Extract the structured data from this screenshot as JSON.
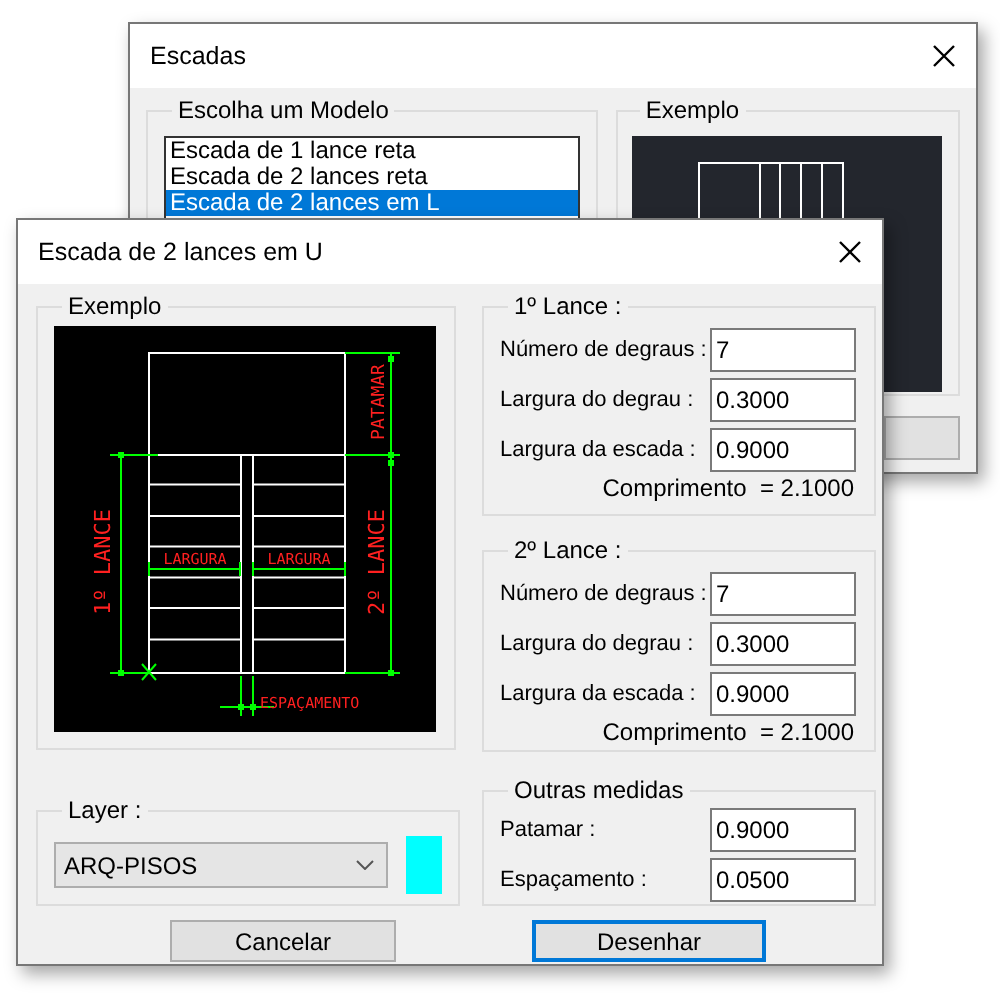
{
  "back_window": {
    "title": "Escadas",
    "model_group": {
      "label": "Escolha um Modelo",
      "items": [
        {
          "label": "Escada de 1 lance reta",
          "selected": false
        },
        {
          "label": "Escada de 2 lances reta",
          "selected": false
        },
        {
          "label": "Escada de 2 lances em L",
          "selected": true
        }
      ]
    },
    "example_group": {
      "label": "Exemplo"
    }
  },
  "dialog": {
    "title": "Escada de 2 lances em U",
    "example": {
      "label": "Exemplo",
      "drawing_labels": [
        "1º LANCE",
        "PATAMAR",
        "2º LANCE",
        "LARGURA",
        "LARGURA",
        "ESPAÇAMENTO"
      ]
    },
    "layer": {
      "label": "Layer :",
      "value": "ARQ-PISOS",
      "color": "#00ffff"
    },
    "lances": [
      {
        "title": "1º Lance :",
        "fields": [
          {
            "label": "Número de degraus :",
            "value": "7"
          },
          {
            "label": "Largura do degrau :",
            "value": "0.3000"
          },
          {
            "label": "Largura da escada :",
            "value": "0.9000"
          }
        ],
        "total": "Comprimento  = 2.1000"
      },
      {
        "title": "2º Lance :",
        "fields": [
          {
            "label": "Número de degraus :",
            "value": "7"
          },
          {
            "label": "Largura do degrau :",
            "value": "0.3000"
          },
          {
            "label": "Largura da escada :",
            "value": "0.9000"
          }
        ],
        "total": "Comprimento  = 2.1000"
      }
    ],
    "other": {
      "title": "Outras medidas",
      "fields": [
        {
          "label": "Patamar :",
          "value": "0.9000"
        },
        {
          "label": "Espaçamento :",
          "value": "0.0500"
        }
      ]
    },
    "buttons": [
      {
        "label": "Cancelar",
        "default": false
      },
      {
        "label": "Desenhar",
        "default": true
      }
    ]
  }
}
